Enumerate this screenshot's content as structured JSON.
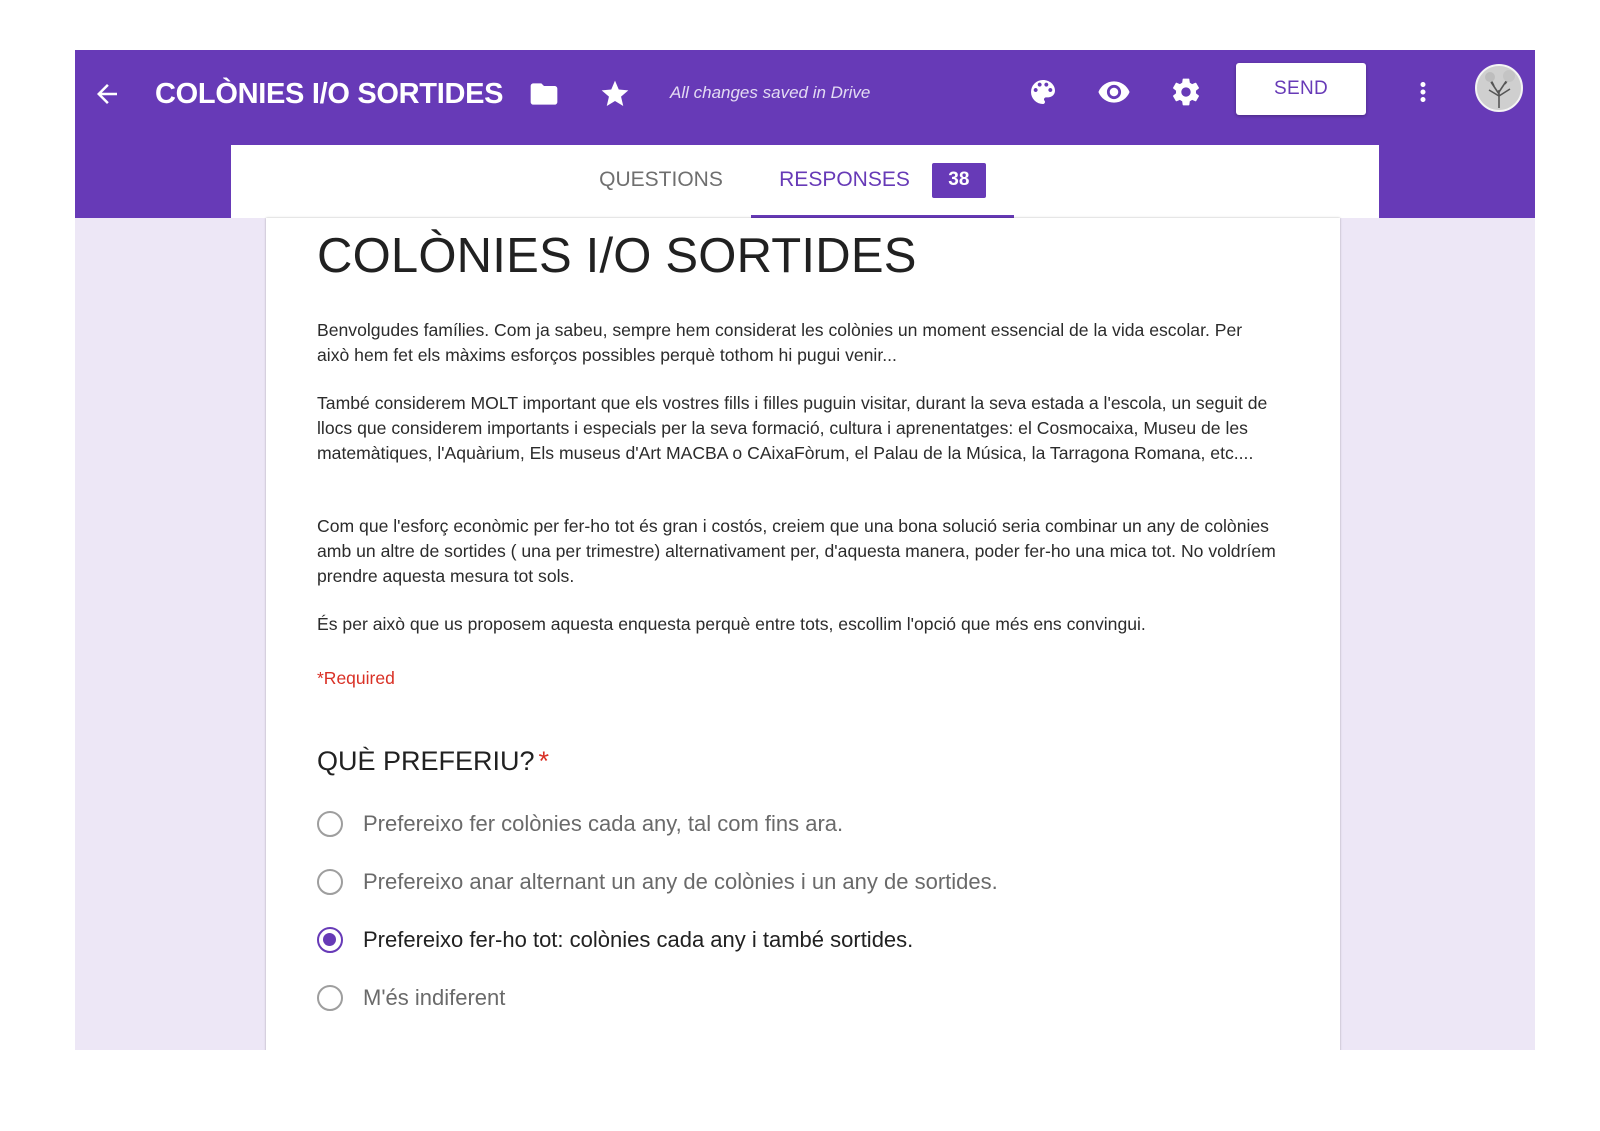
{
  "header": {
    "title": "COLÒNIES I/O SORTIDES",
    "save_status": "All changes saved in Drive",
    "send_label": "SEND",
    "icons": [
      "back-arrow-icon",
      "folder-icon",
      "star-icon",
      "palette-icon",
      "eye-icon",
      "gear-icon",
      "more-vert-icon",
      "avatar"
    ]
  },
  "tabs": {
    "questions": "QUESTIONS",
    "responses": "RESPONSES",
    "responses_count": "38",
    "active": "responses"
  },
  "form": {
    "title": "COLÒNIES I/O SORTIDES",
    "paragraphs": [
      "Benvolgudes famílies. Com ja sabeu, sempre hem considerat les colònies un moment essencial de la vida escolar. Per això hem fet els màxims esforços possibles perquè tothom hi pugui venir...",
      "També considerem MOLT important que els vostres fills i filles puguin visitar, durant la seva estada a l'escola, un seguit de llocs que considerem importants i especials per la seva formació, cultura i aprenentatges: el Cosmocaixa, Museu de les matemàtiques, l'Aquàrium, Els museus d'Art MACBA o CAixaFòrum, el Palau de la Música, la Tarragona Romana, etc....",
      " Com que l'esforç econòmic per fer-ho tot és gran i costós, creiem que una bona solució seria combinar un any de colònies amb un altre de sortides ( una per trimestre) alternativament per, d'aquesta manera, poder fer-ho una mica tot. No voldríem prendre aquesta mesura tot sols.",
      "És per això que us proposem aquesta enquesta perquè entre tots, escollim l'opció que més ens convingui."
    ],
    "required_note": "*Required",
    "question": {
      "title": "QUÈ PREFERIU?",
      "required_mark": "*",
      "options": [
        "Prefereixo fer colònies cada any, tal com fins ara.",
        "Prefereixo anar alternant un any de colònies i un any de sortides.",
        "Prefereixo fer-ho tot: colònies cada any i també sortides.",
        "M'és indiferent"
      ],
      "selected_index": 2
    }
  },
  "colors": {
    "accent": "#673ab7",
    "page_bg": "#ede7f6",
    "required": "#d93025"
  }
}
